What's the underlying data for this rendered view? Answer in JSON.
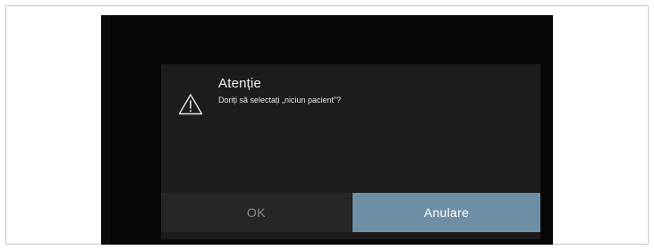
{
  "dialog": {
    "title": "Atenție",
    "message": "Doriți să selectați „niciun pacient”?",
    "icon": "warning-triangle-icon",
    "ok_label": "OK",
    "cancel_label": "Anulare"
  },
  "colors": {
    "screen_background": "#060606",
    "dialog_background": "#1c1c1c",
    "ok_button_background": "#262626",
    "ok_button_text": "#8a8a8a",
    "cancel_button_background": "#6e8fa6",
    "cancel_button_text": "#ffffff"
  }
}
